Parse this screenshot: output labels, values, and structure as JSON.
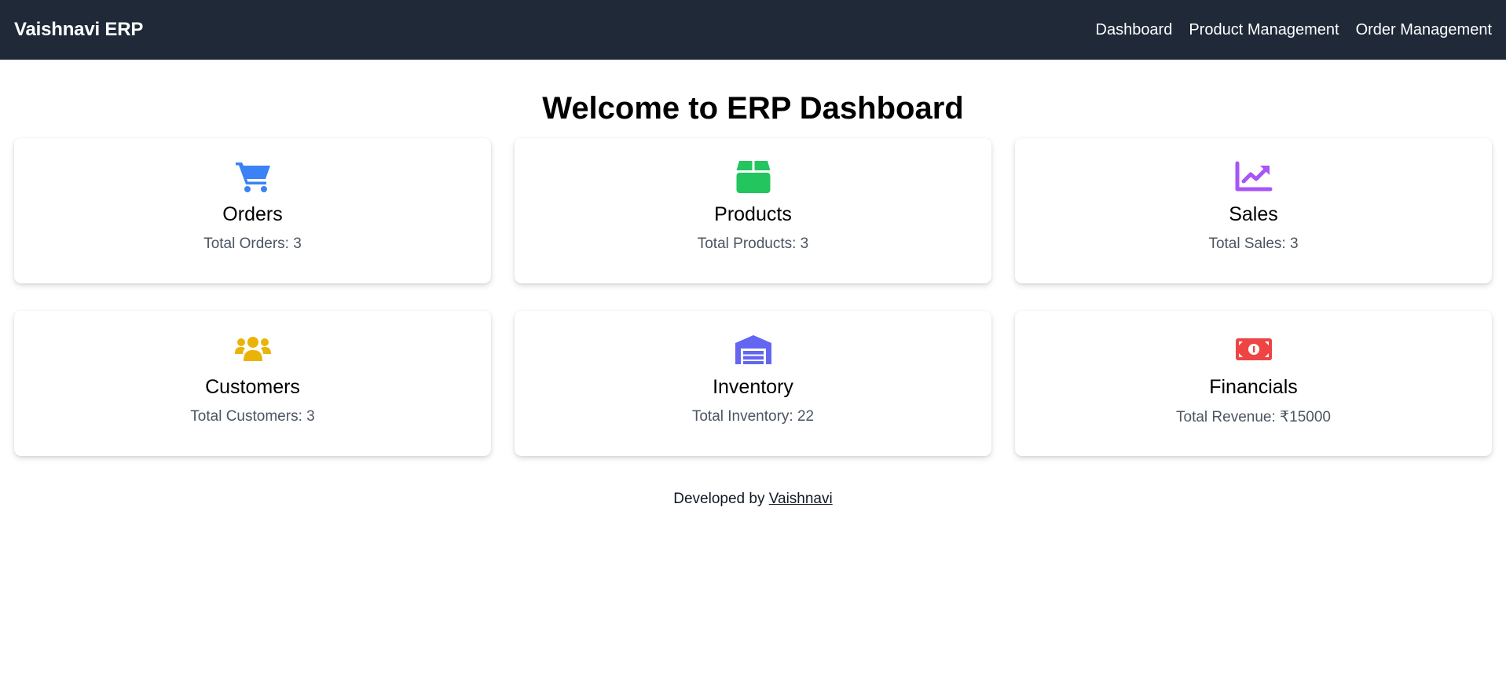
{
  "navbar": {
    "brand": "Vaishnavi ERP",
    "links": [
      "Dashboard",
      "Product Management",
      "Order Management"
    ],
    "background": "#1f2937"
  },
  "page": {
    "title": "Welcome to ERP Dashboard"
  },
  "cards": [
    {
      "icon": "shopping-cart-icon",
      "color": "#3b82f6",
      "title": "Orders",
      "stat": "Total Orders: 3"
    },
    {
      "icon": "box-icon",
      "color": "#22c55e",
      "title": "Products",
      "stat": "Total Products: 3"
    },
    {
      "icon": "chart-line-icon",
      "color": "#a855f7",
      "title": "Sales",
      "stat": "Total Sales: 3"
    },
    {
      "icon": "users-icon",
      "color": "#eab308",
      "title": "Customers",
      "stat": "Total Customers: 3"
    },
    {
      "icon": "warehouse-icon",
      "color": "#6366f1",
      "title": "Inventory",
      "stat": "Total Inventory: 22"
    },
    {
      "icon": "money-bill-icon",
      "color": "#ef4444",
      "title": "Financials",
      "stat": "Total Revenue: ₹15000"
    }
  ],
  "footer": {
    "prefix": "Developed by",
    "author": "Vaishnavi"
  }
}
